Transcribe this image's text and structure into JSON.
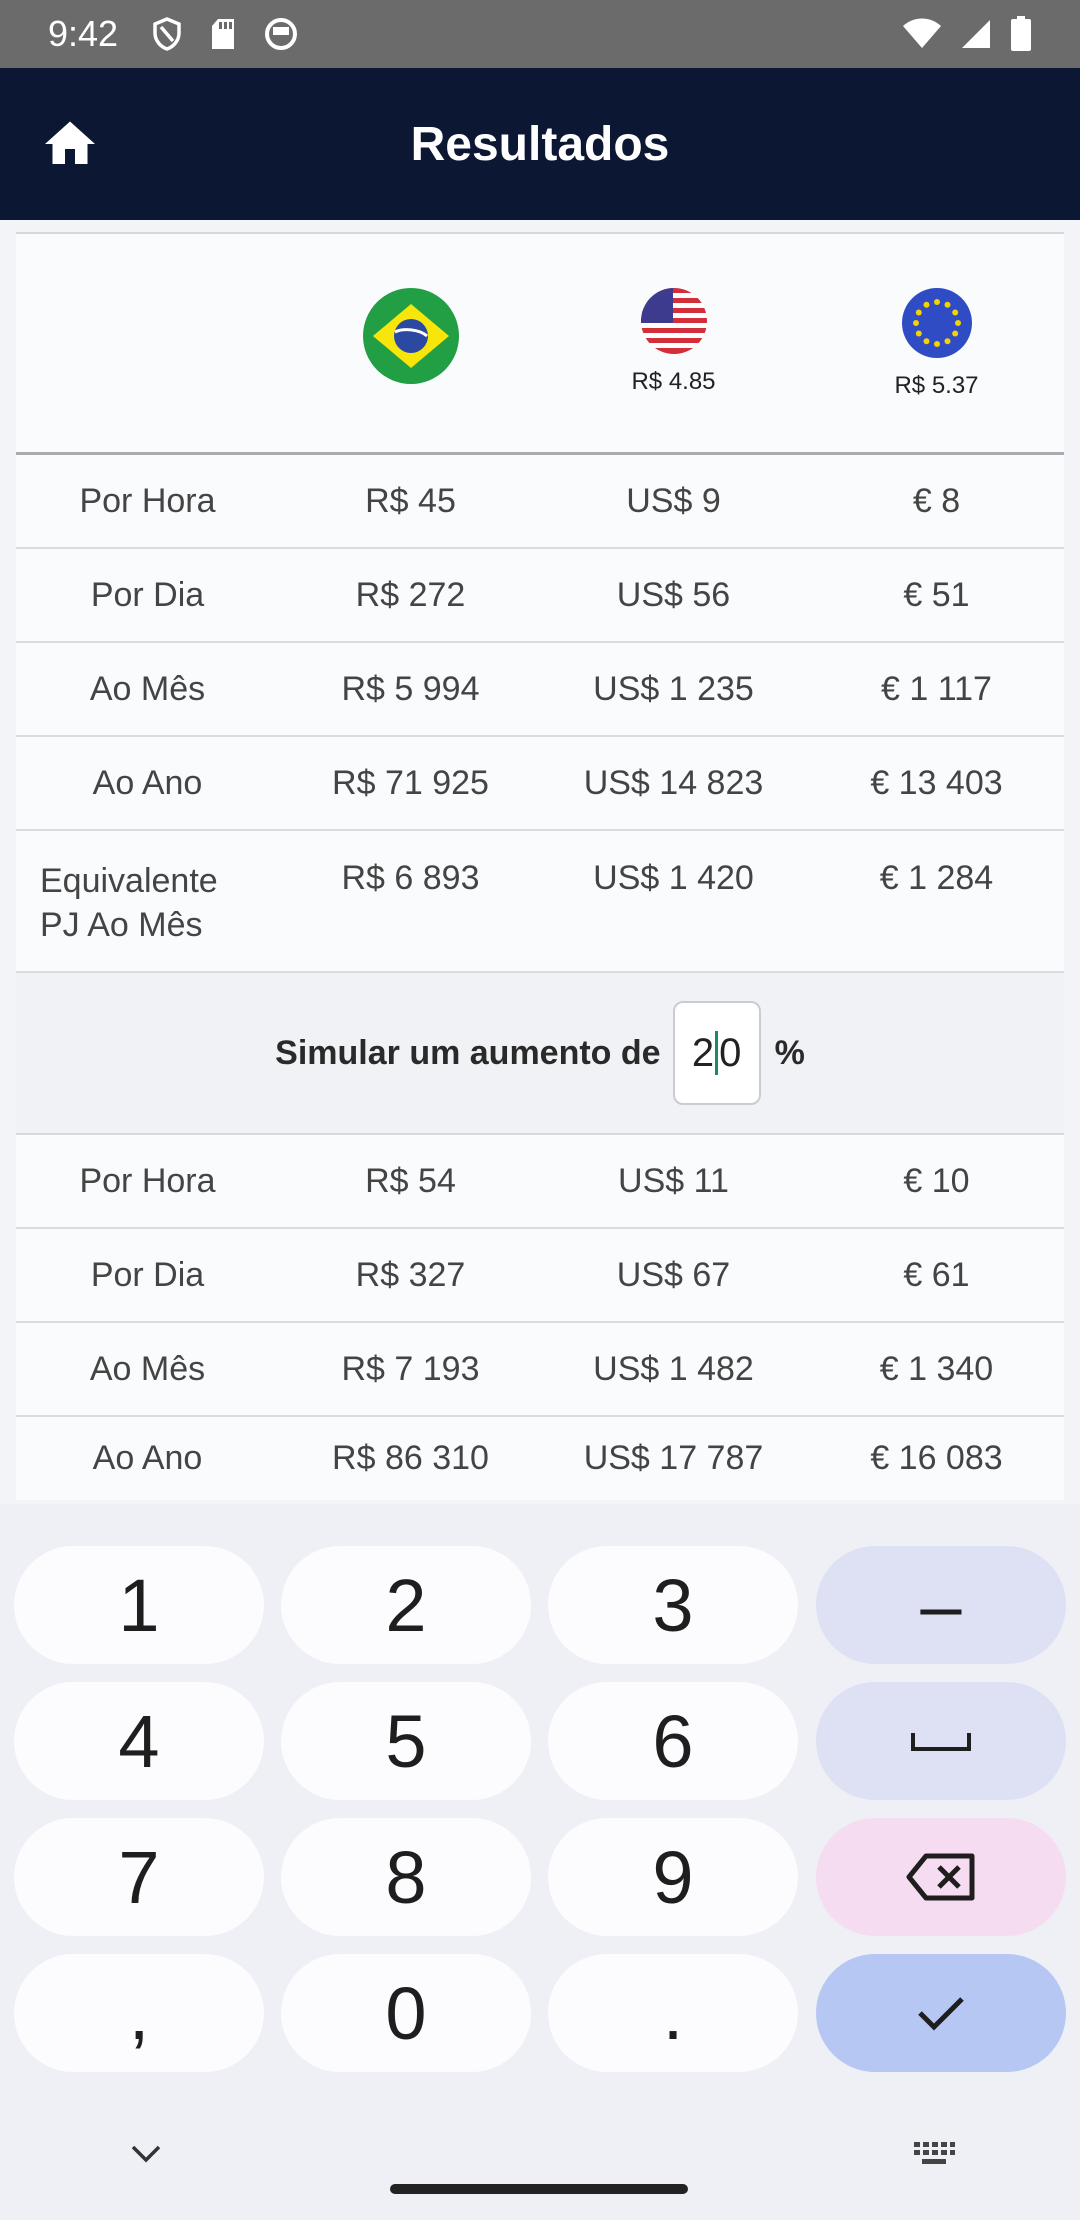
{
  "status_bar": {
    "time": "9:42"
  },
  "app_bar": {
    "title": "Resultados",
    "home_icon": "home-icon"
  },
  "currencies": [
    {
      "flag": "brazil-flag-icon",
      "rate": ""
    },
    {
      "flag": "usa-flag-icon",
      "rate": "R$ 4.85"
    },
    {
      "flag": "eu-flag-icon",
      "rate": "R$ 5.37"
    }
  ],
  "current": [
    {
      "label": "Por Hora",
      "brl": "R$ 45",
      "usd": "US$ 9",
      "eur": "€ 8"
    },
    {
      "label": "Por Dia",
      "brl": "R$ 272",
      "usd": "US$ 56",
      "eur": "€ 51"
    },
    {
      "label": "Ao Mês",
      "brl": "R$ 5 994",
      "usd": "US$ 1 235",
      "eur": "€ 1 117"
    },
    {
      "label": "Ao Ano",
      "brl": "R$ 71 925",
      "usd": "US$ 14 823",
      "eur": "€ 13 403"
    },
    {
      "label_line1": "Equivalente",
      "label_line2": "PJ Ao Mês",
      "brl": "R$ 6 893",
      "usd": "US$ 1 420",
      "eur": "€ 1 284"
    }
  ],
  "simulate": {
    "label": "Simular um aumento de",
    "value_before_cursor": "2",
    "value_after_cursor": "0",
    "unit": "%"
  },
  "simulated": [
    {
      "label": "Por Hora",
      "brl": "R$ 54",
      "usd": "US$ 11",
      "eur": "€ 10"
    },
    {
      "label": "Por Dia",
      "brl": "R$ 327",
      "usd": "US$ 67",
      "eur": "€ 61"
    },
    {
      "label": "Ao Mês",
      "brl": "R$ 7 193",
      "usd": "US$ 1 482",
      "eur": "€ 1 340"
    },
    {
      "label": "Ao Ano",
      "brl": "R$ 86 310",
      "usd": "US$ 17 787",
      "eur": "€ 16 083"
    }
  ],
  "keyboard": {
    "keys": [
      "1",
      "2",
      "3",
      "–",
      "4",
      "5",
      "6",
      "7",
      "8",
      "9",
      ",",
      "0",
      "."
    ],
    "space_icon": "space-icon",
    "backspace_icon": "backspace-icon",
    "done_icon": "check-icon",
    "collapse_icon": "chevron-down-icon",
    "switch_icon": "keyboard-icon"
  },
  "colors": {
    "app_bar": "#0c1733",
    "status_bar": "#6b6b6b",
    "accent": "#b6c7f4"
  }
}
